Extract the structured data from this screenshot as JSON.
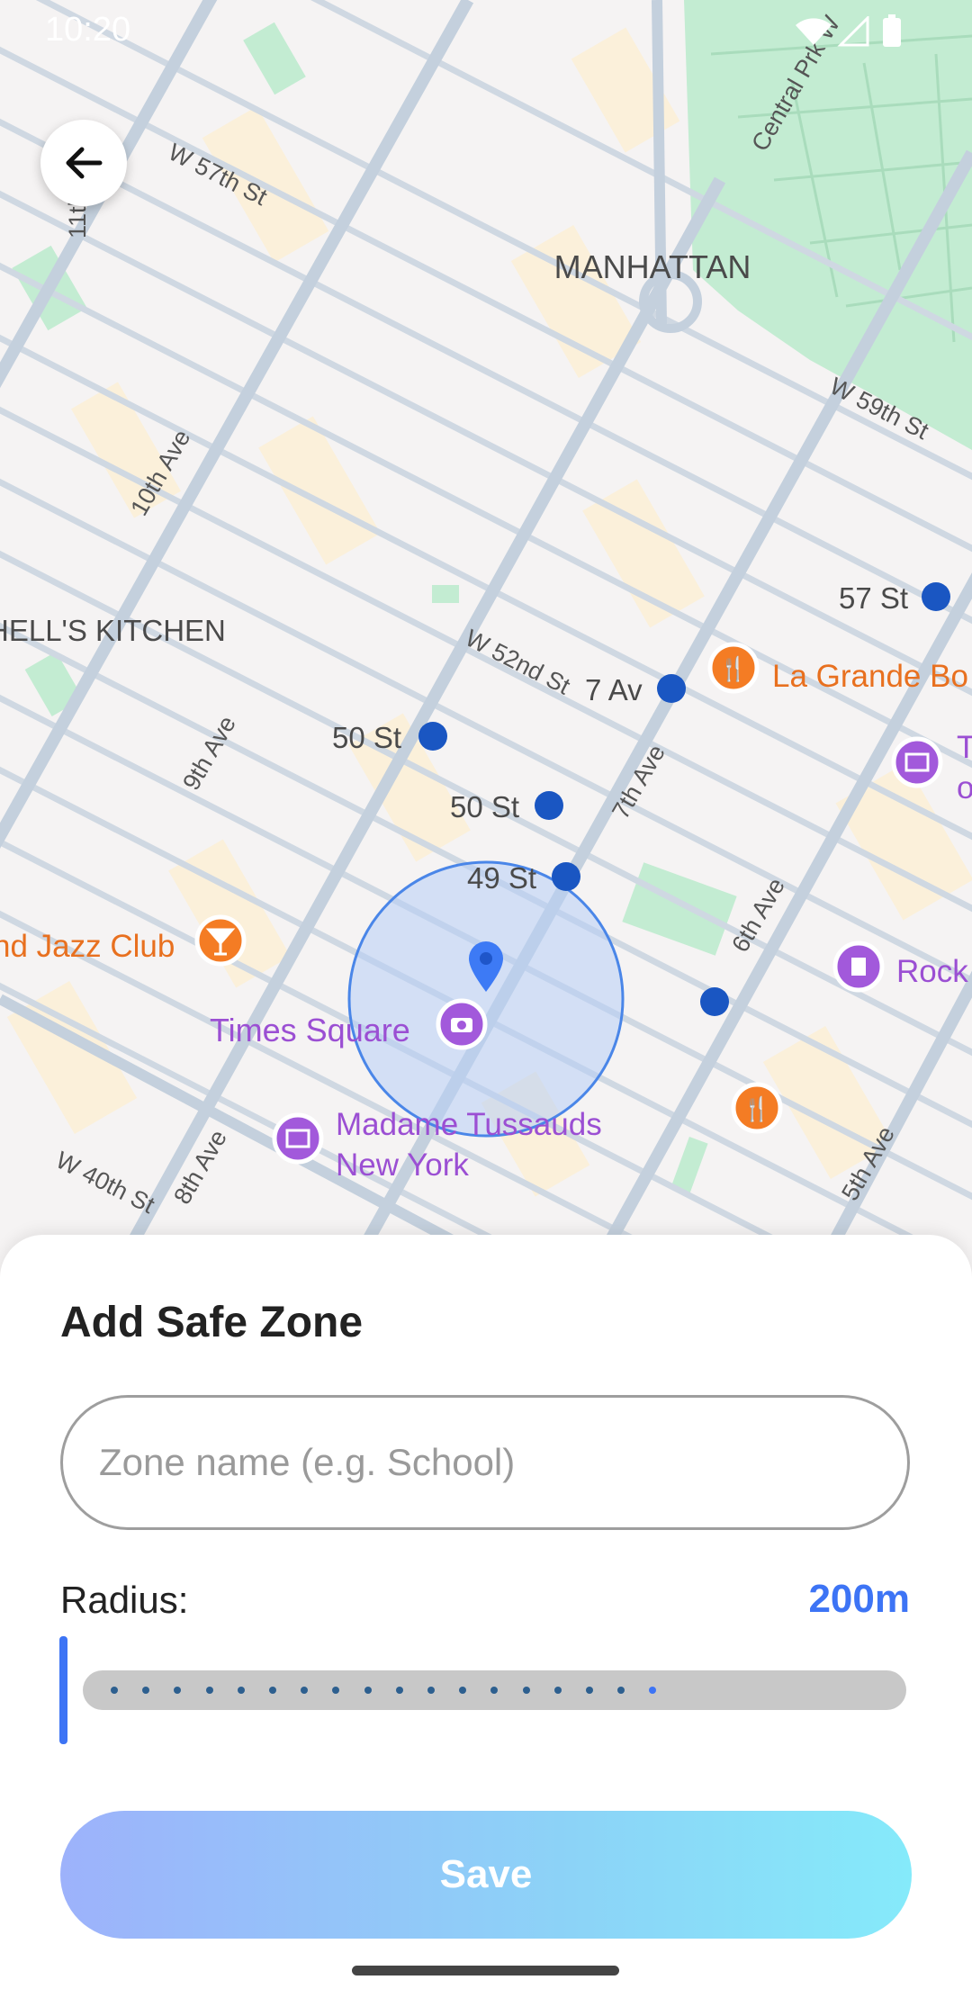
{
  "status_bar": {
    "time": "10:20"
  },
  "map": {
    "district_labels": [
      "MANHATTAN",
      "HELL'S KITCHEN"
    ],
    "street_labels": [
      "W 57th St",
      "W 59th St",
      "W 52nd St",
      "W 40th St",
      "10th Ave",
      "9th Ave",
      "8th Ave",
      "7th Ave",
      "6th Ave",
      "5th Ave",
      "Central Prk W",
      "11th"
    ],
    "transit_labels": [
      "57 St",
      "7 Av",
      "50 St",
      "50 St",
      "49 St"
    ],
    "place_labels": {
      "la_grande": "La Grande Bo",
      "jazz_club": "nd Jazz Club",
      "times_square": "Times Square",
      "madame_line1": "Madame Tussauds",
      "madame_line2": "New York",
      "rock": "Rock",
      "partial_t": "T",
      "partial_o": "o"
    },
    "colors": {
      "base": "#f5f3f3",
      "park": "#c3ecd2",
      "block": "#fbf0da",
      "road": "#cdd6e0",
      "zone_fill": "#b6cef6",
      "zone_stroke": "#4a86e8",
      "pin": "#3d7af5",
      "food": "#f47c24",
      "attraction": "#a259db",
      "transit": "#1a56c2"
    }
  },
  "sheet": {
    "title": "Add Safe Zone",
    "zone_input": {
      "placeholder": "Zone name (e.g. School)",
      "value": ""
    },
    "radius": {
      "label": "Radius:",
      "value": "200m",
      "value_color": "#3d74f5"
    },
    "slider": {
      "value": 0,
      "ticks": 18,
      "thumb_color": "#3d74f5"
    },
    "save_label": "Save"
  }
}
